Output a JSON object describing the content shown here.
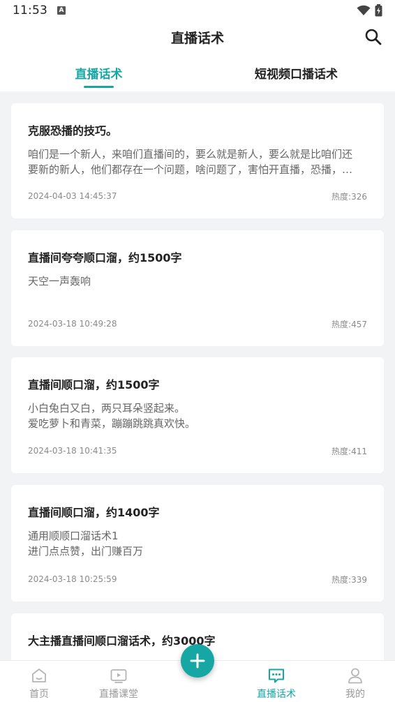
{
  "status_bar": {
    "time": "11:53",
    "notification_glyph": "A"
  },
  "app_bar": {
    "title": "直播话术"
  },
  "tabs": [
    {
      "label": "直播话术",
      "active": true
    },
    {
      "label": "短视频口播话术",
      "active": false
    }
  ],
  "articles": [
    {
      "title": "克服恐播的技巧。",
      "lines": [
        "咱们是一个新人，来咱们直播间的，要么就是新人，要么就是比咱们还",
        "要新的新人，他们都存在一个问题，啥问题了，害怕开直播，恐播，…"
      ],
      "date": "2024-04-03 14:45:37",
      "heat": "热度:326"
    },
    {
      "title": "直播间夸夸顺口溜，约1500字",
      "lines": [
        "天空一声轰响"
      ],
      "date": "2024-03-18 10:49:28",
      "heat": "热度:457"
    },
    {
      "title": "直播间顺口溜，约1500字",
      "lines": [
        "小白兔白又白，两只耳朵竖起来。",
        "爱吃萝卜和青菜，蹦蹦跳跳真欢快。"
      ],
      "date": "2024-03-18 10:41:35",
      "heat": "热度:411"
    },
    {
      "title": "直播间顺口溜，约1400字",
      "lines": [
        "通用顺顺口溜话术1",
        "进门点点赞，出门赚百万"
      ],
      "date": "2024-03-18 10:25:59",
      "heat": "热度:339"
    },
    {
      "title": "大主播直播间顺口溜话术，约3000字",
      "lines": [],
      "date": "",
      "heat": ""
    }
  ],
  "bottom_nav": [
    {
      "label": "首页",
      "icon": "home-icon",
      "active": false
    },
    {
      "label": "直播课堂",
      "icon": "video-icon",
      "active": false
    },
    {
      "label": "直播话术",
      "icon": "chat-icon",
      "active": true
    },
    {
      "label": "我的",
      "icon": "person-icon",
      "active": false
    }
  ],
  "colors": {
    "accent": "#16a7a4",
    "background": "#f2f3f5",
    "card": "#ffffff",
    "muted_text": "#8a8a8a"
  }
}
